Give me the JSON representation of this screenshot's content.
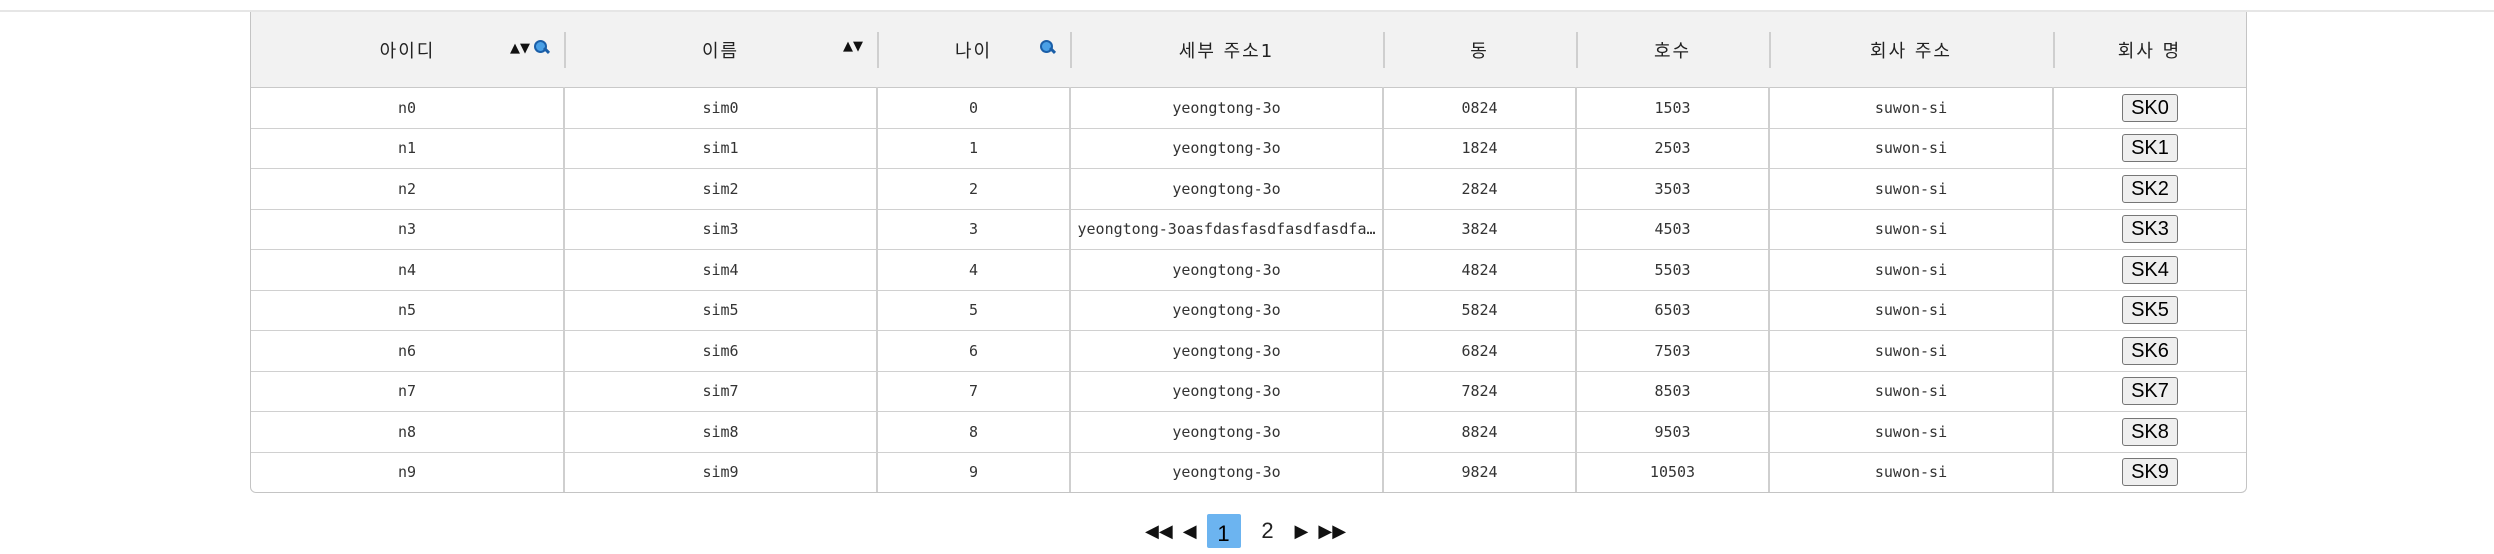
{
  "grid": {
    "columns": [
      {
        "label": "아이디",
        "sortable": true,
        "searchable": true
      },
      {
        "label": "이름",
        "sortable": true,
        "searchable": false
      },
      {
        "label": "나이",
        "sortable": false,
        "searchable": true
      },
      {
        "label": "세부 주소1",
        "sortable": false,
        "searchable": false
      },
      {
        "label": "동",
        "sortable": false,
        "searchable": false
      },
      {
        "label": "호수",
        "sortable": false,
        "searchable": false
      },
      {
        "label": "회사 주소",
        "sortable": false,
        "searchable": false
      },
      {
        "label": "회사 명",
        "sortable": false,
        "searchable": false
      }
    ],
    "sort_glyphs": "▲▼",
    "rows": [
      {
        "id": "n0",
        "name": "sim0",
        "age": "0",
        "address": "yeongtong-3o",
        "dong": "0824",
        "unit": "1503",
        "company_address": "suwon-si",
        "company": "SK0"
      },
      {
        "id": "n1",
        "name": "sim1",
        "age": "1",
        "address": "yeongtong-3o",
        "dong": "1824",
        "unit": "2503",
        "company_address": "suwon-si",
        "company": "SK1"
      },
      {
        "id": "n2",
        "name": "sim2",
        "age": "2",
        "address": "yeongtong-3o",
        "dong": "2824",
        "unit": "3503",
        "company_address": "suwon-si",
        "company": "SK2"
      },
      {
        "id": "n3",
        "name": "sim3",
        "age": "3",
        "address": "yeongtong-3oasfdasfasdfasdfasdfa…",
        "dong": "3824",
        "unit": "4503",
        "company_address": "suwon-si",
        "company": "SK3"
      },
      {
        "id": "n4",
        "name": "sim4",
        "age": "4",
        "address": "yeongtong-3o",
        "dong": "4824",
        "unit": "5503",
        "company_address": "suwon-si",
        "company": "SK4"
      },
      {
        "id": "n5",
        "name": "sim5",
        "age": "5",
        "address": "yeongtong-3o",
        "dong": "5824",
        "unit": "6503",
        "company_address": "suwon-si",
        "company": "SK5"
      },
      {
        "id": "n6",
        "name": "sim6",
        "age": "6",
        "address": "yeongtong-3o",
        "dong": "6824",
        "unit": "7503",
        "company_address": "suwon-si",
        "company": "SK6"
      },
      {
        "id": "n7",
        "name": "sim7",
        "age": "7",
        "address": "yeongtong-3o",
        "dong": "7824",
        "unit": "8503",
        "company_address": "suwon-si",
        "company": "SK7"
      },
      {
        "id": "n8",
        "name": "sim8",
        "age": "8",
        "address": "yeongtong-3o",
        "dong": "8824",
        "unit": "9503",
        "company_address": "suwon-si",
        "company": "SK8"
      },
      {
        "id": "n9",
        "name": "sim9",
        "age": "9",
        "address": "yeongtong-3o",
        "dong": "9824",
        "unit": "10503",
        "company_address": "suwon-si",
        "company": "SK9"
      }
    ]
  },
  "pagination": {
    "first_glyph": "◀◀",
    "prev_glyph": "◀",
    "pages": [
      "1",
      "2"
    ],
    "current": "1",
    "next_glyph": "▶",
    "last_glyph": "▶▶",
    "active_color": "#6cb4f0"
  }
}
